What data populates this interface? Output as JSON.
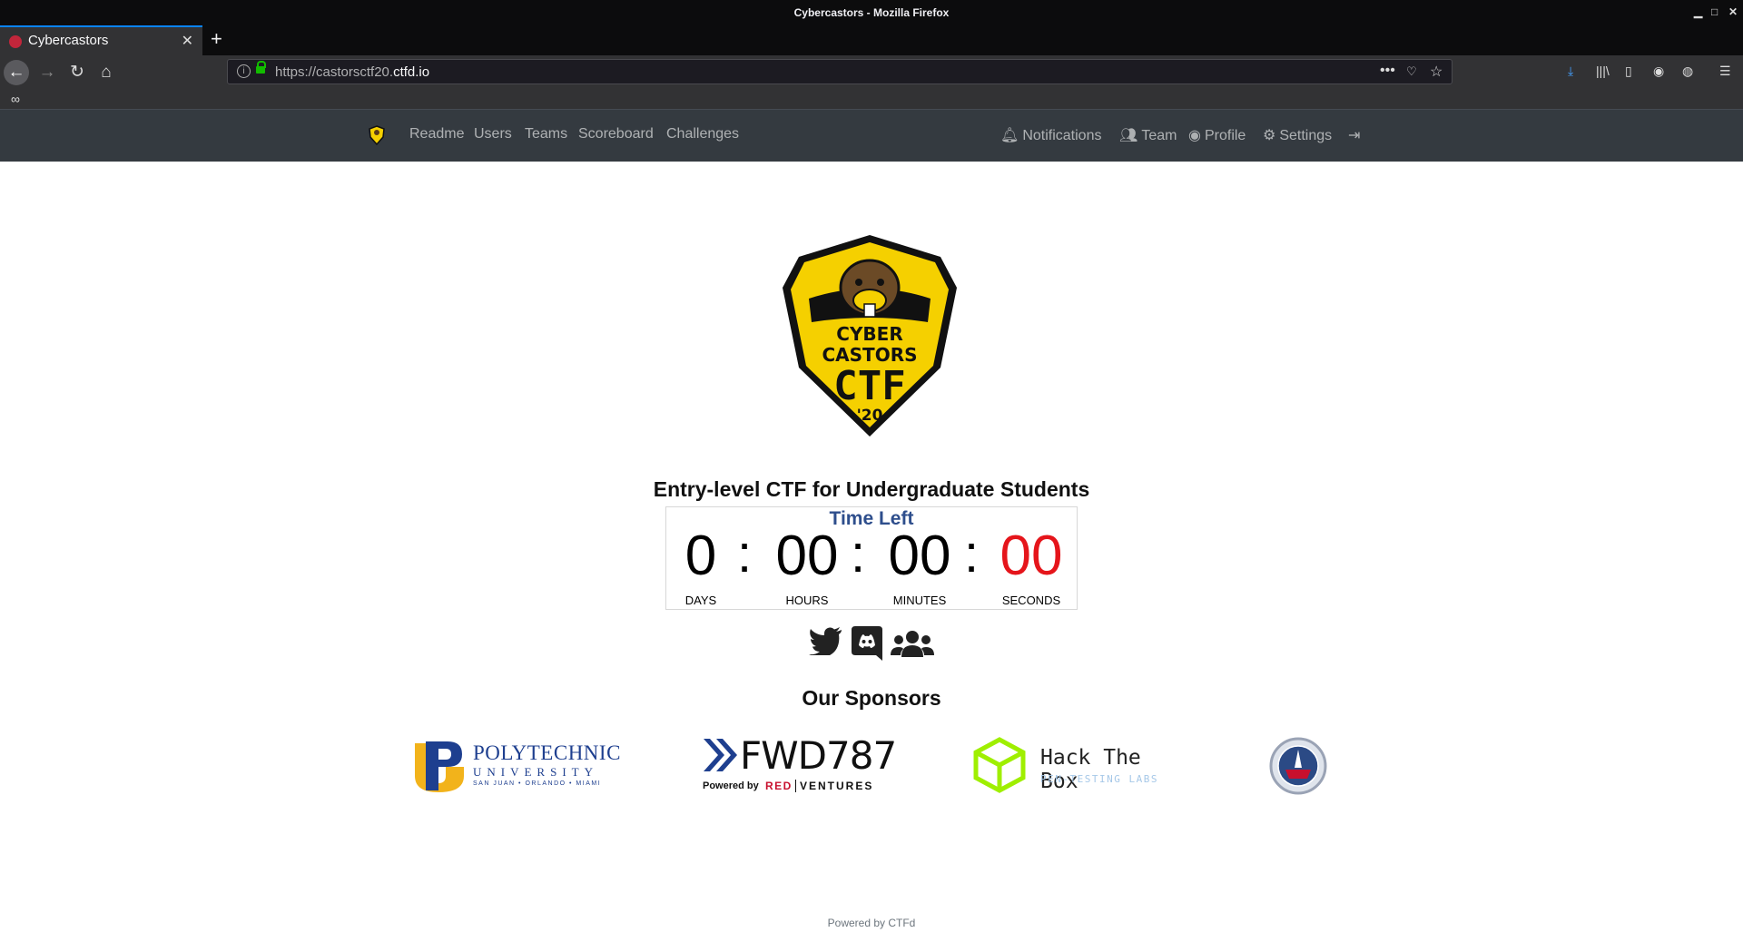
{
  "window": {
    "title": "Cybercastors - Mozilla Firefox",
    "minimize": "▁",
    "maximize": "□",
    "close": "✕"
  },
  "tab": {
    "label": "Cybercastors",
    "close": "✕",
    "new_tab": "+"
  },
  "navbar": {
    "url_host_prefix": "https://castorsctf20.",
    "url_host_main": "ctfd.io",
    "page_actions": "•••"
  },
  "ctfd_nav": {
    "left": [
      "Readme",
      "Users",
      "Teams",
      "Scoreboard",
      "Challenges"
    ],
    "notifications": "Notifications",
    "team": "Team",
    "profile": "Profile",
    "settings": "Settings"
  },
  "logo": {
    "line1": "CYBER",
    "line2": "CASTORS",
    "line3": "CTF",
    "line4": "'20"
  },
  "main": {
    "subtitle": "Entry-level CTF for Undergraduate Students",
    "countdown": {
      "heading": "Time Left",
      "days": "0",
      "hours": "00",
      "minutes": "00",
      "seconds": "00",
      "days_label": "DAYS",
      "hours_label": "HOURS",
      "minutes_label": "MINUTES",
      "seconds_label": "SECONDS",
      "separator": ":"
    },
    "social": [
      "twitter-icon",
      "discord-icon",
      "users-icon"
    ],
    "sponsors_title": "Our Sponsors",
    "sponsors": {
      "polytechnic": {
        "line1": "POLYTECHNIC",
        "line2": "UNIVERSITY",
        "line3": "SAN JUAN • ORLANDO • MIAMI"
      },
      "fwd": {
        "name": "FWD787",
        "powered": "Powered by",
        "red": "RED",
        "ventures": "VENTURES"
      },
      "htb": {
        "name": "Hack The Box",
        "sub": "PEN-TESTING LABS"
      }
    },
    "powered_by": "Powered by CTFd"
  },
  "colors": {
    "accent_yellow": "#f5d000",
    "seconds_red": "#e5151b",
    "heading_blue": "#2e4e8c",
    "navbar_bg": "#343a40"
  }
}
